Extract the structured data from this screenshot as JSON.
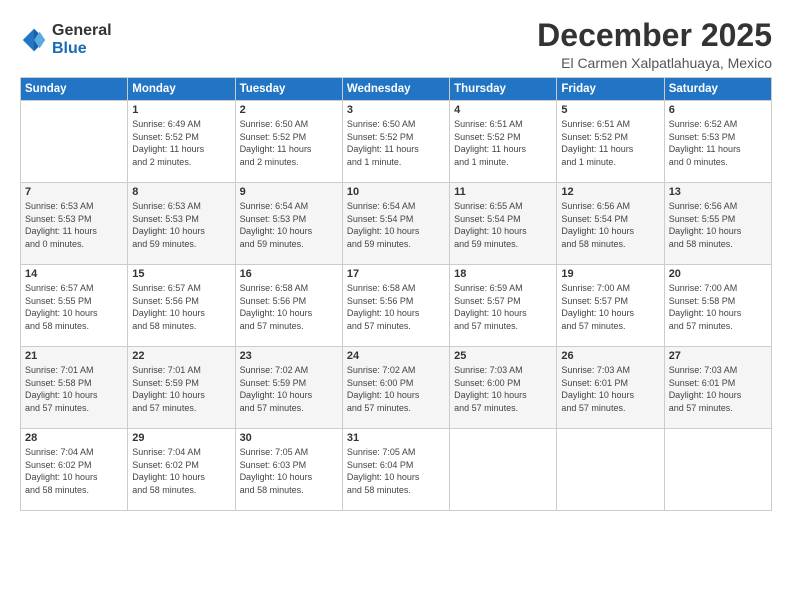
{
  "logo": {
    "general": "General",
    "blue": "Blue"
  },
  "title": "December 2025",
  "subtitle": "El Carmen Xalpatlahuaya, Mexico",
  "headers": [
    "Sunday",
    "Monday",
    "Tuesday",
    "Wednesday",
    "Thursday",
    "Friday",
    "Saturday"
  ],
  "weeks": [
    [
      {
        "day": "",
        "info": ""
      },
      {
        "day": "1",
        "info": "Sunrise: 6:49 AM\nSunset: 5:52 PM\nDaylight: 11 hours\nand 2 minutes."
      },
      {
        "day": "2",
        "info": "Sunrise: 6:50 AM\nSunset: 5:52 PM\nDaylight: 11 hours\nand 2 minutes."
      },
      {
        "day": "3",
        "info": "Sunrise: 6:50 AM\nSunset: 5:52 PM\nDaylight: 11 hours\nand 1 minute."
      },
      {
        "day": "4",
        "info": "Sunrise: 6:51 AM\nSunset: 5:52 PM\nDaylight: 11 hours\nand 1 minute."
      },
      {
        "day": "5",
        "info": "Sunrise: 6:51 AM\nSunset: 5:52 PM\nDaylight: 11 hours\nand 1 minute."
      },
      {
        "day": "6",
        "info": "Sunrise: 6:52 AM\nSunset: 5:53 PM\nDaylight: 11 hours\nand 0 minutes."
      }
    ],
    [
      {
        "day": "7",
        "info": "Sunrise: 6:53 AM\nSunset: 5:53 PM\nDaylight: 11 hours\nand 0 minutes."
      },
      {
        "day": "8",
        "info": "Sunrise: 6:53 AM\nSunset: 5:53 PM\nDaylight: 10 hours\nand 59 minutes."
      },
      {
        "day": "9",
        "info": "Sunrise: 6:54 AM\nSunset: 5:53 PM\nDaylight: 10 hours\nand 59 minutes."
      },
      {
        "day": "10",
        "info": "Sunrise: 6:54 AM\nSunset: 5:54 PM\nDaylight: 10 hours\nand 59 minutes."
      },
      {
        "day": "11",
        "info": "Sunrise: 6:55 AM\nSunset: 5:54 PM\nDaylight: 10 hours\nand 59 minutes."
      },
      {
        "day": "12",
        "info": "Sunrise: 6:56 AM\nSunset: 5:54 PM\nDaylight: 10 hours\nand 58 minutes."
      },
      {
        "day": "13",
        "info": "Sunrise: 6:56 AM\nSunset: 5:55 PM\nDaylight: 10 hours\nand 58 minutes."
      }
    ],
    [
      {
        "day": "14",
        "info": "Sunrise: 6:57 AM\nSunset: 5:55 PM\nDaylight: 10 hours\nand 58 minutes."
      },
      {
        "day": "15",
        "info": "Sunrise: 6:57 AM\nSunset: 5:56 PM\nDaylight: 10 hours\nand 58 minutes."
      },
      {
        "day": "16",
        "info": "Sunrise: 6:58 AM\nSunset: 5:56 PM\nDaylight: 10 hours\nand 57 minutes."
      },
      {
        "day": "17",
        "info": "Sunrise: 6:58 AM\nSunset: 5:56 PM\nDaylight: 10 hours\nand 57 minutes."
      },
      {
        "day": "18",
        "info": "Sunrise: 6:59 AM\nSunset: 5:57 PM\nDaylight: 10 hours\nand 57 minutes."
      },
      {
        "day": "19",
        "info": "Sunrise: 7:00 AM\nSunset: 5:57 PM\nDaylight: 10 hours\nand 57 minutes."
      },
      {
        "day": "20",
        "info": "Sunrise: 7:00 AM\nSunset: 5:58 PM\nDaylight: 10 hours\nand 57 minutes."
      }
    ],
    [
      {
        "day": "21",
        "info": "Sunrise: 7:01 AM\nSunset: 5:58 PM\nDaylight: 10 hours\nand 57 minutes."
      },
      {
        "day": "22",
        "info": "Sunrise: 7:01 AM\nSunset: 5:59 PM\nDaylight: 10 hours\nand 57 minutes."
      },
      {
        "day": "23",
        "info": "Sunrise: 7:02 AM\nSunset: 5:59 PM\nDaylight: 10 hours\nand 57 minutes."
      },
      {
        "day": "24",
        "info": "Sunrise: 7:02 AM\nSunset: 6:00 PM\nDaylight: 10 hours\nand 57 minutes."
      },
      {
        "day": "25",
        "info": "Sunrise: 7:03 AM\nSunset: 6:00 PM\nDaylight: 10 hours\nand 57 minutes."
      },
      {
        "day": "26",
        "info": "Sunrise: 7:03 AM\nSunset: 6:01 PM\nDaylight: 10 hours\nand 57 minutes."
      },
      {
        "day": "27",
        "info": "Sunrise: 7:03 AM\nSunset: 6:01 PM\nDaylight: 10 hours\nand 57 minutes."
      }
    ],
    [
      {
        "day": "28",
        "info": "Sunrise: 7:04 AM\nSunset: 6:02 PM\nDaylight: 10 hours\nand 58 minutes."
      },
      {
        "day": "29",
        "info": "Sunrise: 7:04 AM\nSunset: 6:02 PM\nDaylight: 10 hours\nand 58 minutes."
      },
      {
        "day": "30",
        "info": "Sunrise: 7:05 AM\nSunset: 6:03 PM\nDaylight: 10 hours\nand 58 minutes."
      },
      {
        "day": "31",
        "info": "Sunrise: 7:05 AM\nSunset: 6:04 PM\nDaylight: 10 hours\nand 58 minutes."
      },
      {
        "day": "",
        "info": ""
      },
      {
        "day": "",
        "info": ""
      },
      {
        "day": "",
        "info": ""
      }
    ]
  ]
}
